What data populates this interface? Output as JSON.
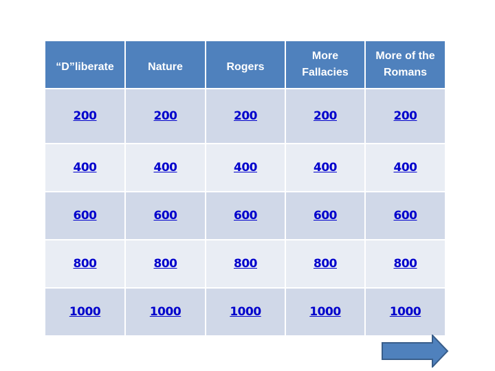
{
  "board": {
    "categories": [
      "“D”liberate",
      "Nature",
      "Rogers",
      "More Fallacies",
      "More of the Romans"
    ],
    "rows": [
      [
        "200",
        "200",
        "200",
        "200",
        "200"
      ],
      [
        "400",
        "400",
        "400",
        "400",
        "400"
      ],
      [
        "600",
        "600",
        "600",
        "600",
        "600"
      ],
      [
        "800",
        "800",
        "800",
        "800",
        "800"
      ],
      [
        "1000",
        "1000",
        "1000",
        "1000",
        "1000"
      ]
    ]
  },
  "navigation": {
    "next_icon": "right-arrow-icon"
  },
  "colors": {
    "header": "#4f81bd",
    "row_dark": "#d0d8e8",
    "row_light": "#e9edf4",
    "link": "#0000cc"
  }
}
